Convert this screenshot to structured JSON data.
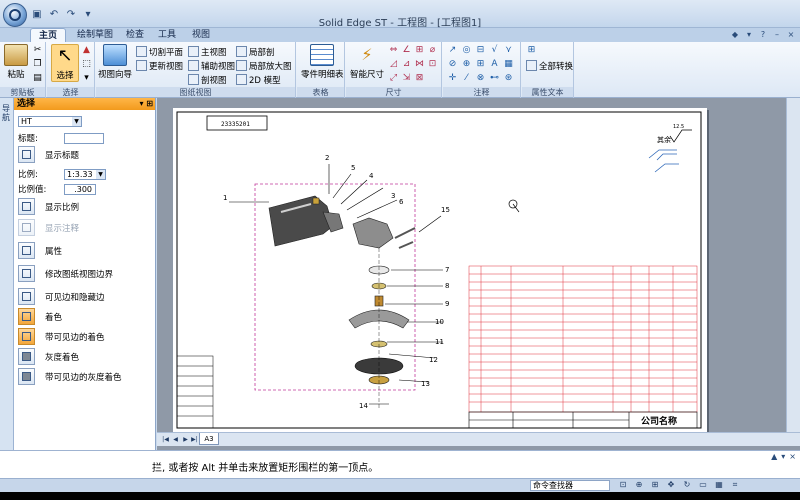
{
  "window": {
    "title": "Solid Edge ST - 工程图 - [工程图1]"
  },
  "ribbon": {
    "tabs": [
      "主页",
      "绘制草图",
      "检查",
      "工具",
      "视图"
    ],
    "active_tab": "主页",
    "groups": {
      "clipboard": {
        "label": "剪贴板",
        "paste": "粘贴"
      },
      "select": {
        "label": "选择",
        "select": "选择"
      },
      "drawing_views": {
        "label": "图纸视图",
        "view_wizard": "视图向导",
        "cut_plane": "切割平面",
        "update_views": "更新视图",
        "principal_view": "主视图",
        "auxiliary_view": "辅助视图",
        "section_view": "剖视图",
        "broken_view": "局部剖",
        "detail_view": "局部放大图",
        "2d_model": "2D 模型"
      },
      "tables": {
        "label": "表格",
        "parts_list": "零件明细表"
      },
      "dimension": {
        "label": "尺寸",
        "smart_dimension": "智能尺寸"
      },
      "annotation": {
        "label": "注释"
      },
      "property_text": {
        "label": "属性文本",
        "convert_all": "全部转换"
      }
    }
  },
  "sidebar": {
    "tab_label": "导航"
  },
  "panel": {
    "header": "选择",
    "style_select": "HT",
    "caption_label": "标题:",
    "caption_value": "",
    "show_caption": "显示标题",
    "scale_label": "比例:",
    "scale_value": "1:3.33",
    "scale_value_label": "比例值:",
    "scale_number": ".300",
    "show_scale": "显示比例",
    "show_annotations": "显示注释",
    "properties": "属性",
    "modify_border": "修改图纸视图边界",
    "visible_hidden": "可见边和隐藏边",
    "shaded": "着色",
    "shaded_visible_edges": "带可见边的着色",
    "gray_shaded": "灰度着色",
    "gray_shaded_visible_edges": "带可见边的灰度着色"
  },
  "drawing": {
    "part_number": "23335201",
    "roughness_label": "其余",
    "roughness_value": "12.5",
    "callouts": [
      "1",
      "2",
      "3",
      "4",
      "5",
      "6",
      "7",
      "8",
      "9",
      "10",
      "11",
      "12",
      "13",
      "14",
      "15"
    ],
    "company_name": "公司名称",
    "sheet_tab": "A3",
    "colors": {
      "title_block_lines": "#e0303a",
      "border": "#000000",
      "view_frame": "#c0389a",
      "leader": "#000000"
    }
  },
  "command": {
    "prompt": "拦, 或者按 Alt 并单击来放置矩形围栏的第一顶点。",
    "finder": "命令查找器"
  }
}
